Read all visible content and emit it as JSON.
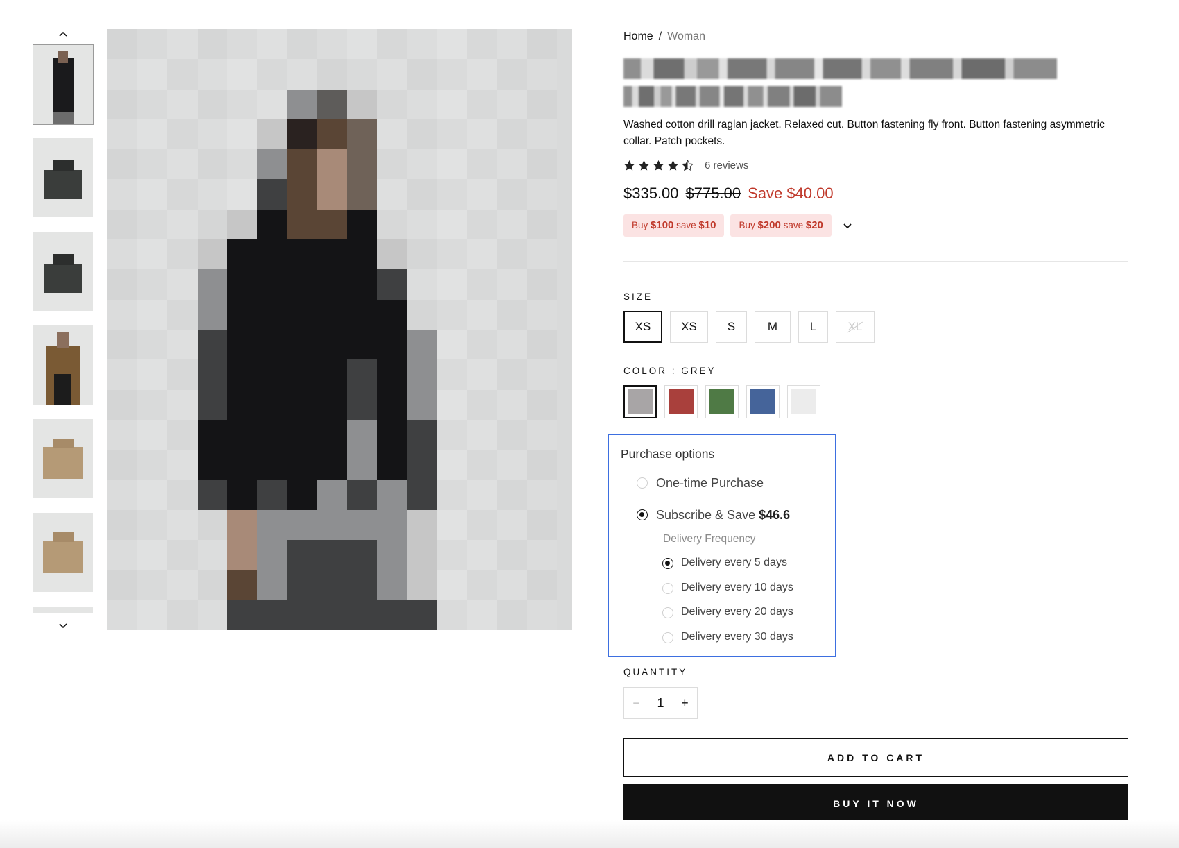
{
  "breadcrumb": {
    "home": "Home",
    "separator": "/",
    "current": "Woman"
  },
  "product": {
    "description": "Washed cotton drill raglan jacket. Relaxed cut. Button fastening fly front. Button fastening asymmetric collar. Patch pockets.",
    "rating": 4.5,
    "reviews_label": "6 reviews",
    "price": "$335.00",
    "compare_price": "$775.00",
    "save_label": "Save $40.00",
    "promo_1": {
      "prefix": "Buy ",
      "amount": "$100",
      "mid": " save ",
      "save": "$10"
    },
    "promo_2": {
      "prefix": "Buy ",
      "amount": "$200",
      "mid": " save ",
      "save": "$20"
    }
  },
  "size": {
    "label": "SIZE",
    "options": [
      "XS",
      "XS",
      "S",
      "M",
      "L",
      "XL"
    ],
    "selected_index": 0,
    "disabled_index": 5
  },
  "color": {
    "label": "COLOR : GREY",
    "swatches": [
      {
        "name": "grey",
        "hex": "#a8a5a6"
      },
      {
        "name": "red",
        "hex": "#a9403c"
      },
      {
        "name": "green",
        "hex": "#4f7a45"
      },
      {
        "name": "blue",
        "hex": "#45649a"
      },
      {
        "name": "white",
        "hex": "#ececec"
      }
    ],
    "selected_index": 0
  },
  "purchase_options": {
    "title": "Purchase options",
    "one_time": "One-time Purchase",
    "subscribe": "Subscribe & Save",
    "subscribe_price": "$46.6",
    "frequency_label": "Delivery Frequency",
    "frequencies": [
      "Delivery every 5 days",
      "Delivery every 10 days",
      "Delivery every 20 days",
      "Delivery every 30 days"
    ],
    "selected_frequency_index": 0
  },
  "quantity": {
    "label": "QUANTITY",
    "value": "1",
    "minus": "−",
    "plus": "+"
  },
  "buttons": {
    "add_to_cart": "ADD TO CART",
    "buy_now": "BUY IT NOW"
  },
  "colors": {
    "accent_red": "#c0392b",
    "highlight_blue": "#3d6fe0"
  }
}
